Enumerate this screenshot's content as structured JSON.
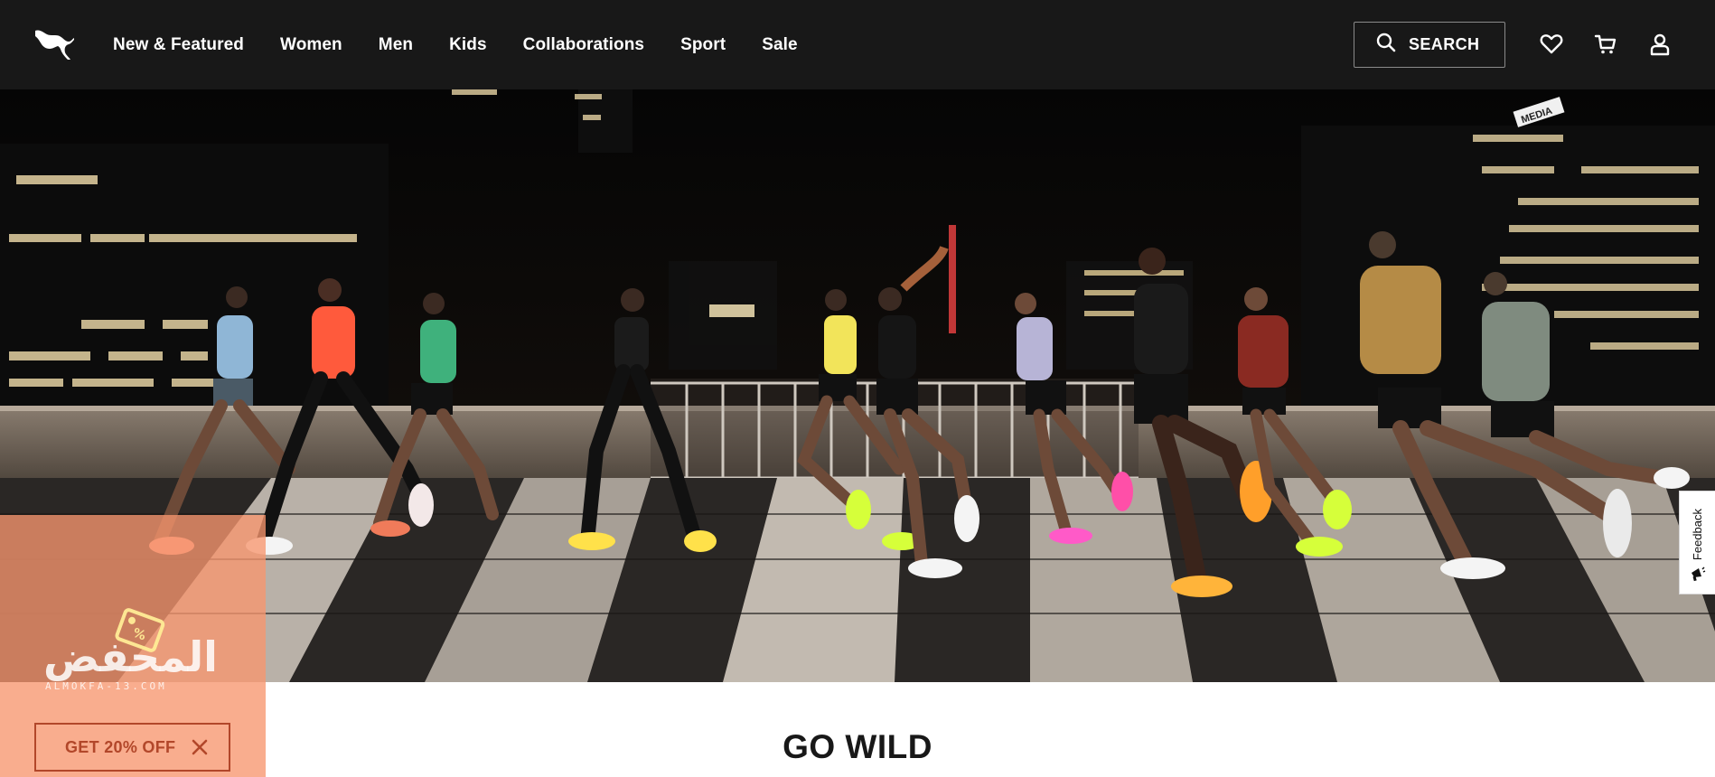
{
  "header": {
    "logo": "puma-logo-icon",
    "nav": [
      {
        "label": "New & Featured"
      },
      {
        "label": "Women"
      },
      {
        "label": "Men"
      },
      {
        "label": "Kids"
      },
      {
        "label": "Collaborations"
      },
      {
        "label": "Sport"
      },
      {
        "label": "Sale"
      }
    ],
    "search_label": "SEARCH",
    "icons": [
      "search-icon",
      "heart-icon",
      "cart-icon",
      "account-icon"
    ]
  },
  "hero": {
    "image": "runners-on-rooftop-night-photo",
    "sign_text": "MEDIA"
  },
  "promo": {
    "watermark_text": "المحفض",
    "watermark_sub": "ALMOKFA-13.COM",
    "button_label": "GET 20% OFF",
    "close_icon": "close-icon",
    "color": "#f7966e",
    "text_color": "#b2472a"
  },
  "feedback": {
    "label": "Feedback",
    "icon": "megaphone-icon"
  },
  "section": {
    "title": "GO WILD"
  },
  "colors": {
    "header_bg": "#181818",
    "text": "#ffffff"
  }
}
